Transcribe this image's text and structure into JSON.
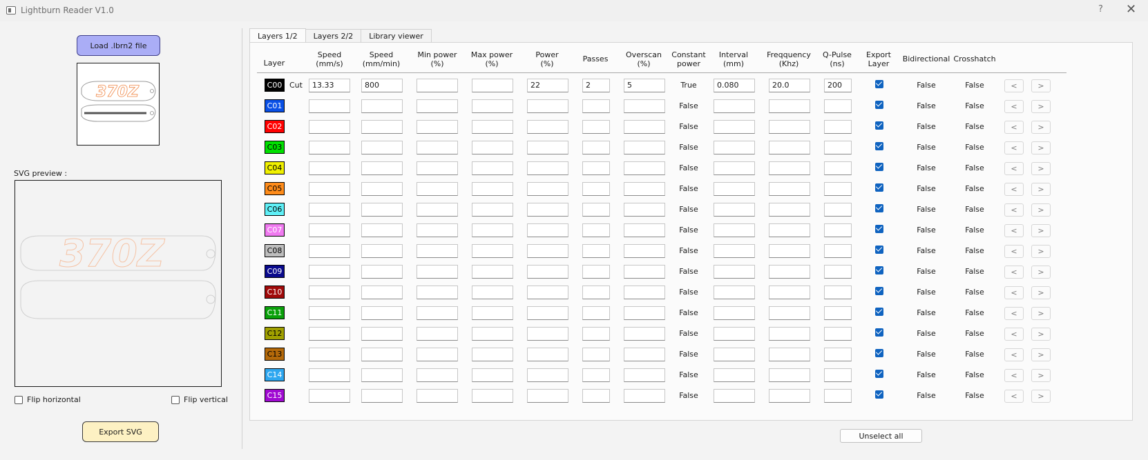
{
  "window": {
    "title": "Lightburn Reader V1.0",
    "help_label": "?",
    "close_label": "✕"
  },
  "left": {
    "load_button": "Load .lbrn2 file",
    "svg_preview_label": "SVG preview :",
    "thumbnail_text": "370Z",
    "preview_text": "370Z",
    "flip_horizontal": "Flip horizontal",
    "flip_vertical": "Flip vertical",
    "export_button": "Export SVG"
  },
  "tabs": [
    "Layers 1/2",
    "Layers 2/2",
    "Library viewer"
  ],
  "headers": [
    {
      "key": "layer",
      "line1": "Layer",
      "line2": ""
    },
    {
      "key": "speed_mms",
      "line1": "Speed",
      "line2": "(mm/s)"
    },
    {
      "key": "speed_mmmin",
      "line1": "Speed",
      "line2": "(mm/min)"
    },
    {
      "key": "min_power",
      "line1": "Min power",
      "line2": "(%)"
    },
    {
      "key": "max_power",
      "line1": "Max power",
      "line2": "(%)"
    },
    {
      "key": "power",
      "line1": "Power",
      "line2": "(%)"
    },
    {
      "key": "passes",
      "line1": "Passes",
      "line2": ""
    },
    {
      "key": "overscan",
      "line1": "Overscan",
      "line2": "(%)"
    },
    {
      "key": "constant_power",
      "line1": "Constant",
      "line2": "power"
    },
    {
      "key": "interval",
      "line1": "Interval",
      "line2": "(mm)"
    },
    {
      "key": "frequency",
      "line1": "Freqquency",
      "line2": "(Khz)"
    },
    {
      "key": "qpulse",
      "line1": "Q-Pulse",
      "line2": "(ns)"
    },
    {
      "key": "export_layer",
      "line1": "Export",
      "line2": "Layer"
    },
    {
      "key": "bidirectional",
      "line1": "Bidirectional",
      "line2": ""
    },
    {
      "key": "crosshatch",
      "line1": "Crosshatch",
      "line2": ""
    }
  ],
  "nav_labels": {
    "prev": "<",
    "next": ">"
  },
  "rows": [
    {
      "layer": "C00",
      "color": "#000000",
      "text_color": "#ffffff",
      "mode": "Cut",
      "speed_mms": "13.33",
      "speed_mmmin": "800",
      "min_power": "",
      "max_power": "",
      "power": "22",
      "passes": "2",
      "overscan": "5",
      "constant_power": "True",
      "interval": "0.080",
      "frequency": "20.0",
      "qpulse": "200",
      "export": true,
      "bidirectional": "False",
      "crosshatch": "False"
    },
    {
      "layer": "C01",
      "color": "#0a50e6",
      "text_color": "#ffffff",
      "mode": "",
      "speed_mms": "",
      "speed_mmmin": "",
      "min_power": "",
      "max_power": "",
      "power": "",
      "passes": "",
      "overscan": "",
      "constant_power": "False",
      "interval": "",
      "frequency": "",
      "qpulse": "",
      "export": true,
      "bidirectional": "False",
      "crosshatch": "False"
    },
    {
      "layer": "C02",
      "color": "#ff0000",
      "text_color": "#ffffff",
      "mode": "",
      "speed_mms": "",
      "speed_mmmin": "",
      "min_power": "",
      "max_power": "",
      "power": "",
      "passes": "",
      "overscan": "",
      "constant_power": "False",
      "interval": "",
      "frequency": "",
      "qpulse": "",
      "export": true,
      "bidirectional": "False",
      "crosshatch": "False"
    },
    {
      "layer": "C03",
      "color": "#00e000",
      "text_color": "#000000",
      "mode": "",
      "speed_mms": "",
      "speed_mmmin": "",
      "min_power": "",
      "max_power": "",
      "power": "",
      "passes": "",
      "overscan": "",
      "constant_power": "False",
      "interval": "",
      "frequency": "",
      "qpulse": "",
      "export": true,
      "bidirectional": "False",
      "crosshatch": "False"
    },
    {
      "layer": "C04",
      "color": "#f0f000",
      "text_color": "#000000",
      "mode": "",
      "speed_mms": "",
      "speed_mmmin": "",
      "min_power": "",
      "max_power": "",
      "power": "",
      "passes": "",
      "overscan": "",
      "constant_power": "False",
      "interval": "",
      "frequency": "",
      "qpulse": "",
      "export": true,
      "bidirectional": "False",
      "crosshatch": "False"
    },
    {
      "layer": "C05",
      "color": "#ff8c1a",
      "text_color": "#000000",
      "mode": "",
      "speed_mms": "",
      "speed_mmmin": "",
      "min_power": "",
      "max_power": "",
      "power": "",
      "passes": "",
      "overscan": "",
      "constant_power": "False",
      "interval": "",
      "frequency": "",
      "qpulse": "",
      "export": true,
      "bidirectional": "False",
      "crosshatch": "False"
    },
    {
      "layer": "C06",
      "color": "#5ff0f7",
      "text_color": "#000000",
      "mode": "",
      "speed_mms": "",
      "speed_mmmin": "",
      "min_power": "",
      "max_power": "",
      "power": "",
      "passes": "",
      "overscan": "",
      "constant_power": "False",
      "interval": "",
      "frequency": "",
      "qpulse": "",
      "export": true,
      "bidirectional": "False",
      "crosshatch": "False"
    },
    {
      "layer": "C07",
      "color": "#f07af0",
      "text_color": "#ffffff",
      "mode": "",
      "speed_mms": "",
      "speed_mmmin": "",
      "min_power": "",
      "max_power": "",
      "power": "",
      "passes": "",
      "overscan": "",
      "constant_power": "False",
      "interval": "",
      "frequency": "",
      "qpulse": "",
      "export": true,
      "bidirectional": "False",
      "crosshatch": "False"
    },
    {
      "layer": "C08",
      "color": "#bdbdbd",
      "text_color": "#000000",
      "mode": "",
      "speed_mms": "",
      "speed_mmmin": "",
      "min_power": "",
      "max_power": "",
      "power": "",
      "passes": "",
      "overscan": "",
      "constant_power": "False",
      "interval": "",
      "frequency": "",
      "qpulse": "",
      "export": true,
      "bidirectional": "False",
      "crosshatch": "False"
    },
    {
      "layer": "C09",
      "color": "#0a0a8c",
      "text_color": "#ffffff",
      "mode": "",
      "speed_mms": "",
      "speed_mmmin": "",
      "min_power": "",
      "max_power": "",
      "power": "",
      "passes": "",
      "overscan": "",
      "constant_power": "False",
      "interval": "",
      "frequency": "",
      "qpulse": "",
      "export": true,
      "bidirectional": "False",
      "crosshatch": "False"
    },
    {
      "layer": "C10",
      "color": "#a00a0a",
      "text_color": "#ffffff",
      "mode": "",
      "speed_mms": "",
      "speed_mmmin": "",
      "min_power": "",
      "max_power": "",
      "power": "",
      "passes": "",
      "overscan": "",
      "constant_power": "False",
      "interval": "",
      "frequency": "",
      "qpulse": "",
      "export": true,
      "bidirectional": "False",
      "crosshatch": "False"
    },
    {
      "layer": "C11",
      "color": "#0aa00a",
      "text_color": "#ffffff",
      "mode": "",
      "speed_mms": "",
      "speed_mmmin": "",
      "min_power": "",
      "max_power": "",
      "power": "",
      "passes": "",
      "overscan": "",
      "constant_power": "False",
      "interval": "",
      "frequency": "",
      "qpulse": "",
      "export": true,
      "bidirectional": "False",
      "crosshatch": "False"
    },
    {
      "layer": "C12",
      "color": "#a0a000",
      "text_color": "#000000",
      "mode": "",
      "speed_mms": "",
      "speed_mmmin": "",
      "min_power": "",
      "max_power": "",
      "power": "",
      "passes": "",
      "overscan": "",
      "constant_power": "False",
      "interval": "",
      "frequency": "",
      "qpulse": "",
      "export": true,
      "bidirectional": "False",
      "crosshatch": "False"
    },
    {
      "layer": "C13",
      "color": "#b4690a",
      "text_color": "#000000",
      "mode": "",
      "speed_mms": "",
      "speed_mmmin": "",
      "min_power": "",
      "max_power": "",
      "power": "",
      "passes": "",
      "overscan": "",
      "constant_power": "False",
      "interval": "",
      "frequency": "",
      "qpulse": "",
      "export": true,
      "bidirectional": "False",
      "crosshatch": "False"
    },
    {
      "layer": "C14",
      "color": "#2ea7f0",
      "text_color": "#ffffff",
      "mode": "",
      "speed_mms": "",
      "speed_mmmin": "",
      "min_power": "",
      "max_power": "",
      "power": "",
      "passes": "",
      "overscan": "",
      "constant_power": "False",
      "interval": "",
      "frequency": "",
      "qpulse": "",
      "export": true,
      "bidirectional": "False",
      "crosshatch": "False"
    },
    {
      "layer": "C15",
      "color": "#a00ad2",
      "text_color": "#ffffff",
      "mode": "",
      "speed_mms": "",
      "speed_mmmin": "",
      "min_power": "",
      "max_power": "",
      "power": "",
      "passes": "",
      "overscan": "",
      "constant_power": "False",
      "interval": "",
      "frequency": "",
      "qpulse": "",
      "export": true,
      "bidirectional": "False",
      "crosshatch": "False"
    }
  ],
  "unselect_all": "Unselect all"
}
